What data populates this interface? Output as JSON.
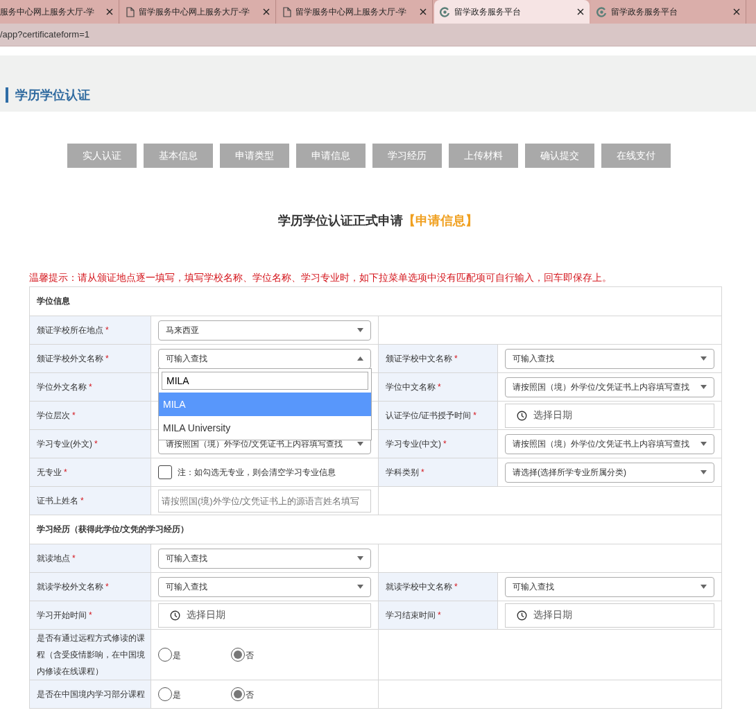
{
  "browser": {
    "tabs": [
      {
        "title": "服务中心网上服务大厅-学",
        "kind": "cut",
        "selected": false
      },
      {
        "title": "留学服务中心网上服务大厅-学",
        "kind": "page",
        "selected": false
      },
      {
        "title": "留学服务中心网上服务大厅-学",
        "kind": "page",
        "selected": false
      },
      {
        "title": "留学政务服务平台",
        "kind": "site",
        "selected": true
      },
      {
        "title": "留学政务服务平台",
        "kind": "site",
        "selected": false
      }
    ],
    "url": "/app?certificateform=1"
  },
  "page_title": "学历学位认证",
  "steps": [
    "实人认证",
    "基本信息",
    "申请类型",
    "申请信息",
    "学习经历",
    "上传材料",
    "确认提交",
    "在线支付"
  ],
  "form_title": {
    "text": "学历学位认证正式申请",
    "stage": "【申请信息】"
  },
  "notice": "温馨提示：请从颁证地点逐一填写，填写学校名称、学位名称、学习专业时，如下拉菜单选项中没有匹配项可自行输入，回车即保存上。",
  "sections": [
    {
      "title": "学位信息",
      "rows": [
        {
          "cells": [
            {
              "label": "颁证学校所在地点",
              "mark": "*",
              "field": {
                "kind": "select",
                "value": "马来西亚"
              }
            }
          ]
        },
        {
          "cells": [
            {
              "label": "颁证学校外文名称",
              "mark": "*",
              "field": {
                "kind": "select",
                "placeholder": "可输入查找",
                "open": true
              }
            },
            {
              "label": "颁证学校中文名称",
              "mark": "*",
              "field": {
                "kind": "select",
                "placeholder": "可输入查找"
              }
            }
          ]
        },
        {
          "cells": [
            {
              "label": "学位外文名称",
              "mark": "*"
            },
            {
              "label": "学位中文名称",
              "mark": "*",
              "field": {
                "kind": "select",
                "placeholder": "请按照国（境）外学位/文凭证书上内容填写查找"
              }
            }
          ]
        },
        {
          "cells": [
            {
              "label": "学位层次",
              "mark": "*"
            },
            {
              "label": "认证学位/证书授予时间",
              "mark": "*",
              "field": {
                "kind": "date",
                "placeholder": "选择日期"
              }
            }
          ]
        },
        {
          "cells": [
            {
              "label": "学习专业(外文)",
              "mark": "*",
              "field": {
                "kind": "select",
                "placeholder": "请按照国（境）外学位/文凭证书上内容填写查找"
              }
            },
            {
              "label": "学习专业(中文)",
              "mark": "*",
              "field": {
                "kind": "select",
                "placeholder": "请按照国（境）外学位/文凭证书上内容填写查找"
              }
            }
          ]
        },
        {
          "cells": [
            {
              "label": "无专业",
              "mark": "*",
              "field": {
                "kind": "checkbox",
                "checked": false,
                "note": "注：如勾选无专业，则会清空学习专业信息"
              }
            },
            {
              "label": "学科类别",
              "mark": "*",
              "field": {
                "kind": "select",
                "placeholder": "请选择(选择所学专业所属分类)"
              }
            }
          ]
        },
        {
          "cells": [
            {
              "label": "证书上姓名",
              "mark": "*",
              "field": {
                "kind": "text",
                "placeholder": "请按照国(境)外学位/文凭证书上的源语言姓名填写"
              }
            }
          ]
        }
      ]
    },
    {
      "title": "学习经历（获得此学位/文凭的学习经历）",
      "rows": [
        {
          "cells": [
            {
              "label": "就读地点",
              "mark": "*",
              "field": {
                "kind": "select",
                "placeholder": "可输入查找"
              }
            }
          ]
        },
        {
          "cells": [
            {
              "label": "就读学校外文名称",
              "mark": "*",
              "field": {
                "kind": "select",
                "placeholder": "可输入查找"
              }
            },
            {
              "label": "就读学校中文名称",
              "mark": "*",
              "field": {
                "kind": "select",
                "placeholder": "可输入查找"
              }
            }
          ]
        },
        {
          "cells": [
            {
              "label": "学习开始时间",
              "mark": "*",
              "field": {
                "kind": "date",
                "placeholder": "选择日期"
              }
            },
            {
              "label": "学习结束时间",
              "mark": "*",
              "field": {
                "kind": "date",
                "placeholder": "选择日期"
              }
            }
          ]
        },
        {
          "cells": [
            {
              "label": "是否有通过远程方式修读的课程（含受疫情影响，在中国境内修读在线课程）",
              "field": {
                "kind": "radio",
                "options": [
                  {
                    "label": "是",
                    "selected": false
                  },
                  {
                    "label": "否",
                    "selected": true
                  }
                ]
              }
            }
          ]
        },
        {
          "cells": [
            {
              "label": "是否在中国境内学习部分课程",
              "field": {
                "kind": "radio",
                "options": [
                  {
                    "label": "是",
                    "selected": false
                  },
                  {
                    "label": "否",
                    "selected": true
                  }
                ]
              }
            }
          ]
        }
      ]
    }
  ],
  "dropdown": {
    "search": "MILA",
    "options": [
      {
        "label": "MILA",
        "selected": true
      },
      {
        "label": "MILA University",
        "selected": false
      }
    ]
  }
}
